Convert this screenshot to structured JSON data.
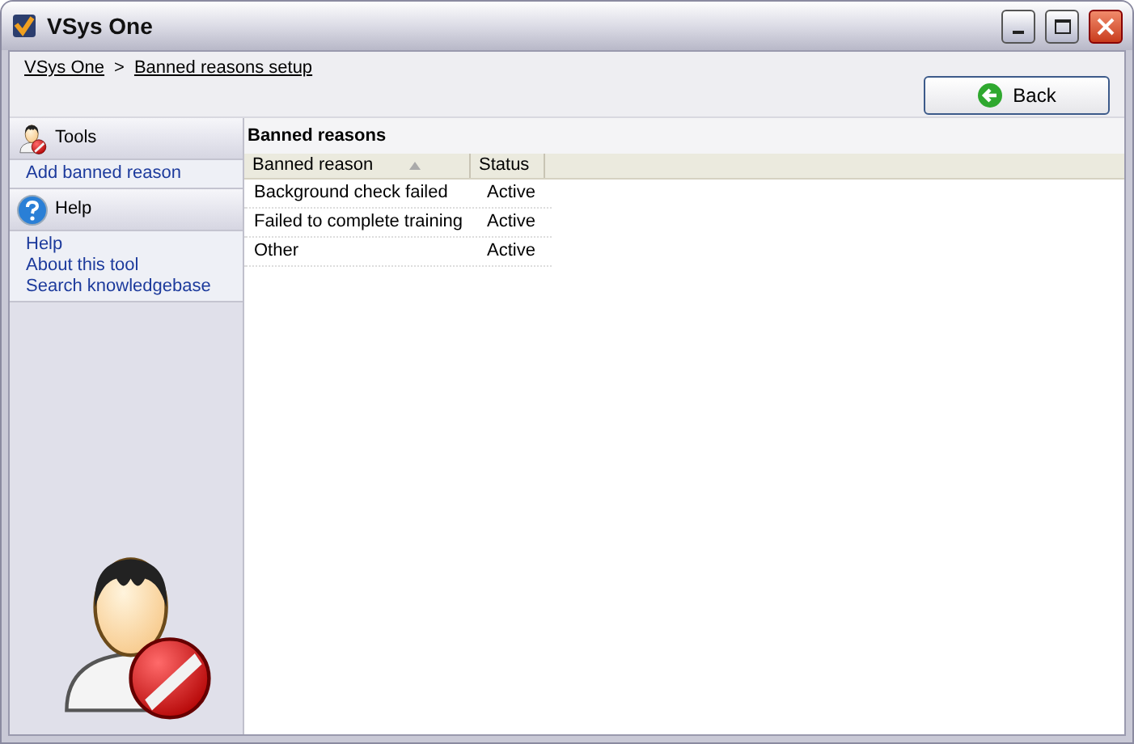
{
  "window": {
    "title": "VSys One"
  },
  "breadcrumb": [
    {
      "label": "VSys One"
    },
    {
      "label": "Banned reasons setup"
    }
  ],
  "breadcrumb_separator": ">",
  "back_button": {
    "label": "Back"
  },
  "sidebar": {
    "sections": [
      {
        "title": "Tools",
        "kind": "tools",
        "items": [
          {
            "label": "Add banned reason"
          }
        ]
      },
      {
        "title": "Help",
        "kind": "help",
        "items": [
          {
            "label": "Help"
          },
          {
            "label": "About this tool"
          },
          {
            "label": "Search knowledgebase"
          }
        ]
      }
    ]
  },
  "panel": {
    "title": "Banned reasons"
  },
  "table": {
    "columns": [
      {
        "label": "Banned reason",
        "sorted": true
      },
      {
        "label": "Status",
        "sorted": false
      }
    ],
    "rows": [
      [
        "Background check failed",
        "Active"
      ],
      [
        "Failed to complete training",
        "Active"
      ],
      [
        "Other",
        "Active"
      ]
    ]
  }
}
